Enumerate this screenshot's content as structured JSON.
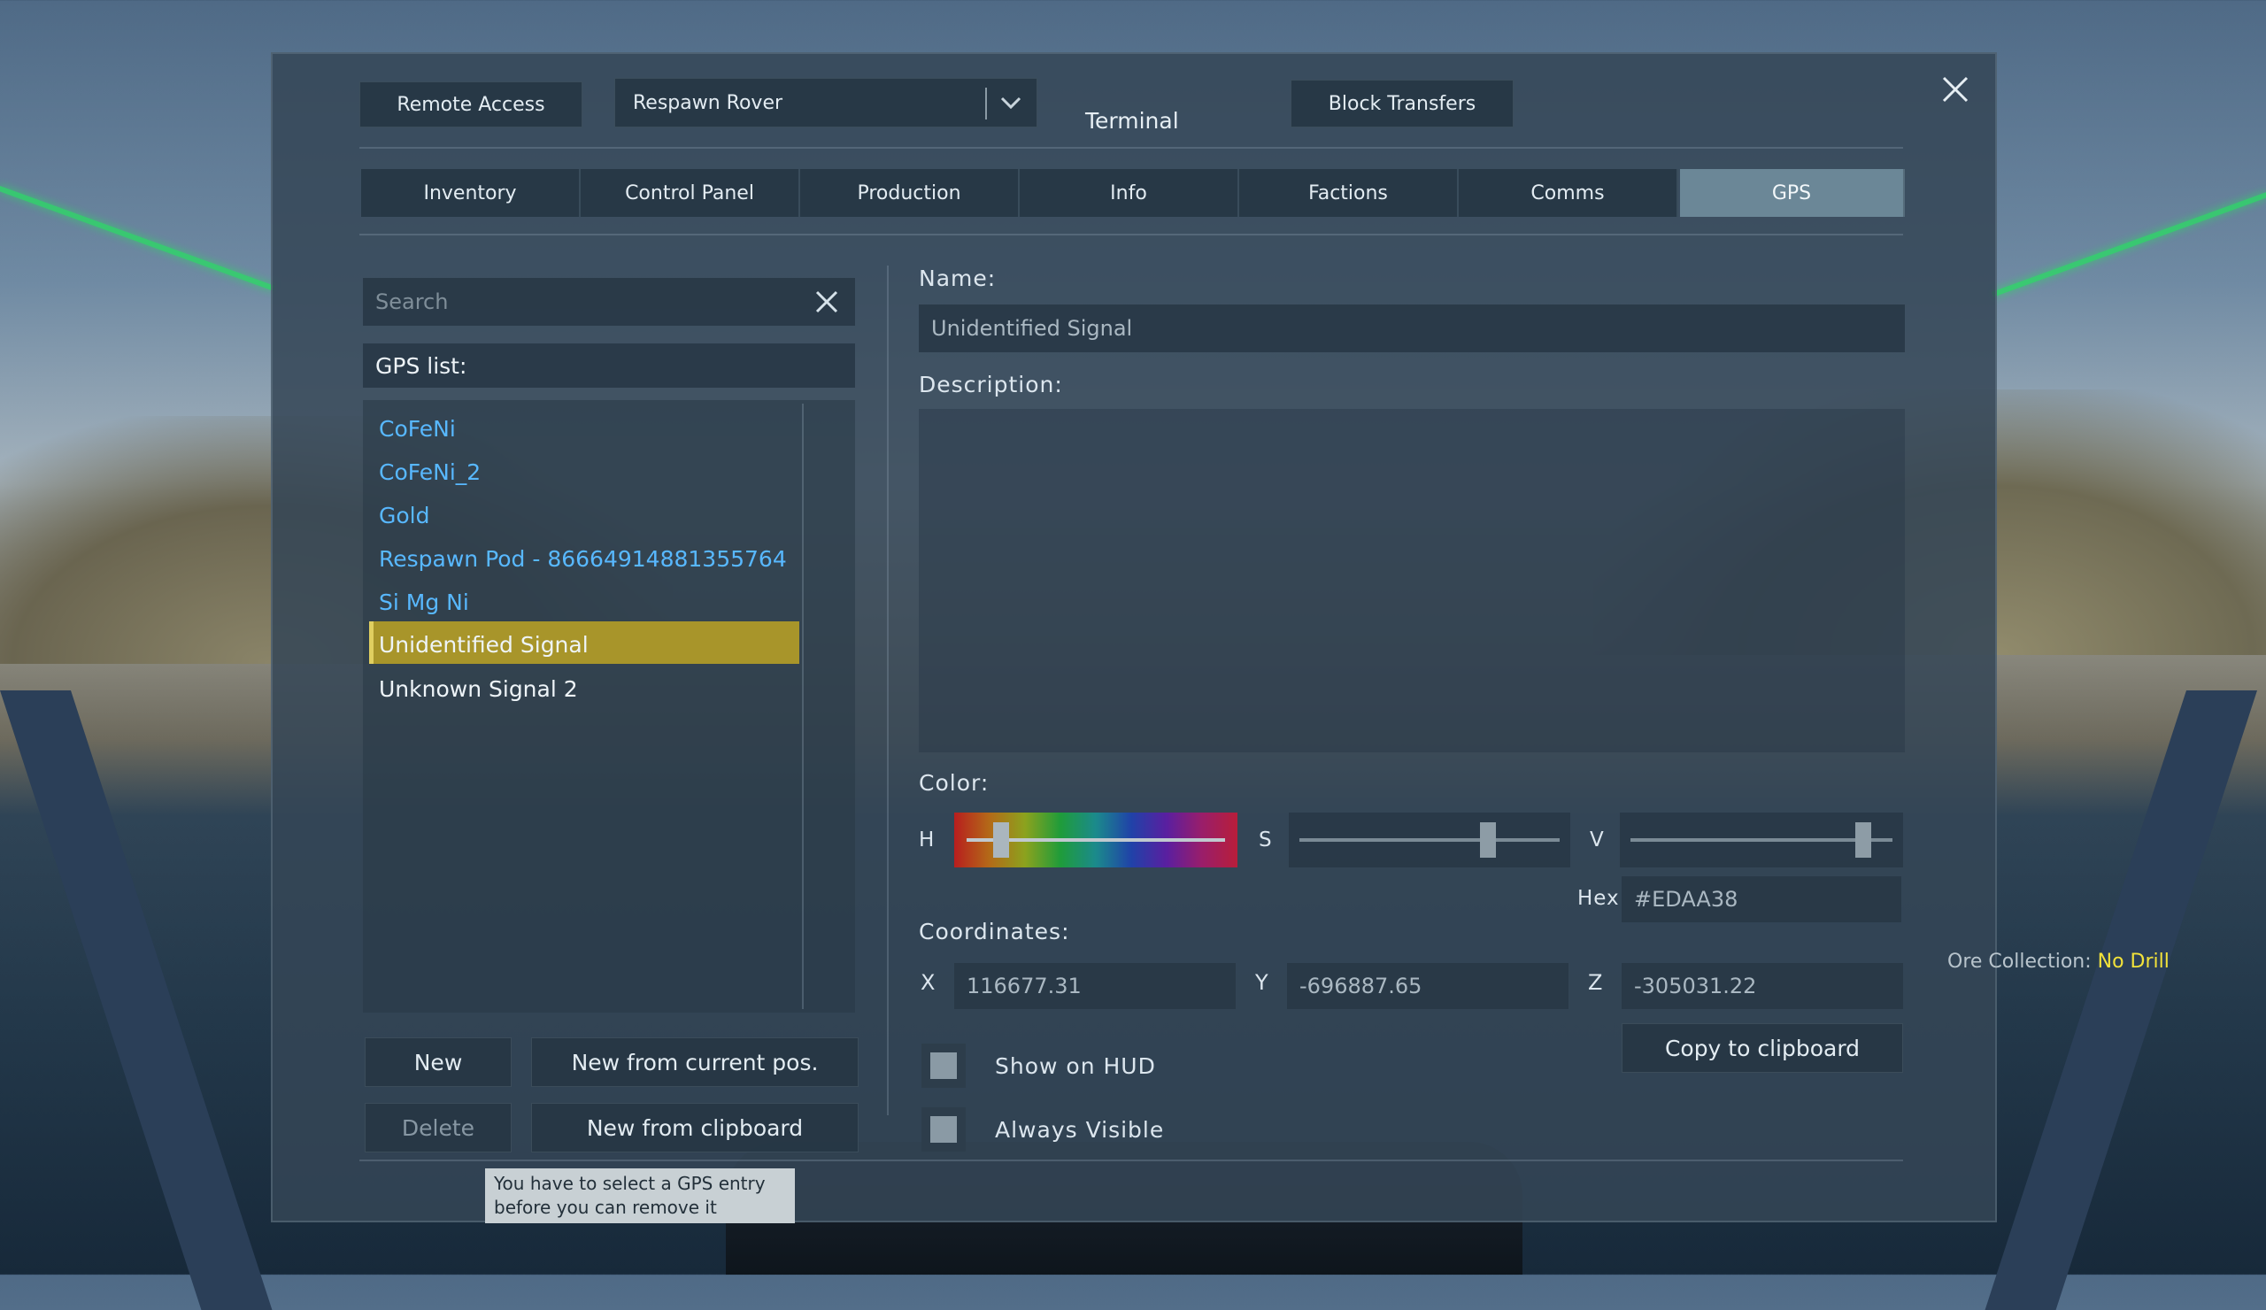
{
  "window": {
    "title": "Terminal"
  },
  "topbar": {
    "remote_access": "Remote Access",
    "block_selector": "Respawn Rover",
    "block_transfers": "Block Transfers"
  },
  "tabs": [
    "Inventory",
    "Control Panel",
    "Production",
    "Info",
    "Factions",
    "Comms",
    "GPS"
  ],
  "active_tab": "GPS",
  "search": {
    "placeholder": "Search"
  },
  "gps_list": {
    "header": "GPS list:",
    "items": [
      {
        "label": "CoFeNi",
        "color": "#58b8ff"
      },
      {
        "label": "CoFeNi_2",
        "color": "#58b8ff"
      },
      {
        "label": "Gold",
        "color": "#58b8ff"
      },
      {
        "label": "Respawn Pod - 86664914881355764",
        "color": "#58b8ff"
      },
      {
        "label": "Si Mg Ni",
        "color": "#58b8ff"
      },
      {
        "label": "Unidentified Signal",
        "color": "#ffffff",
        "selected": true
      },
      {
        "label": "Unknown Signal 2",
        "color": "#ffffff"
      }
    ]
  },
  "buttons": {
    "new": "New",
    "new_current_pos": "New from current pos.",
    "delete": "Delete",
    "new_clipboard": "New from clipboard",
    "copy_clipboard": "Copy to clipboard"
  },
  "tooltip": {
    "line1": "You have to select a GPS entry",
    "line2": "before you can remove it"
  },
  "details": {
    "name_label": "Name:",
    "name_value": "Unidentified Signal",
    "description_label": "Description:",
    "color_label": "Color:",
    "h_label": "H",
    "s_label": "S",
    "v_label": "V",
    "hex_label": "Hex",
    "hex_value": "#EDAA38",
    "coordinates_label": "Coordinates:",
    "x_label": "X",
    "x_value": "116677.31",
    "y_label": "Y",
    "y_value": "-696887.65",
    "z_label": "Z",
    "z_value": "-305031.22",
    "show_on_hud": "Show on  HUD",
    "always_visible": "Always Visible",
    "hue_level": 0.15,
    "saturation_level": 0.7,
    "value_level": 0.9
  },
  "hud": {
    "ore_label": "Ore Collection:",
    "ore_value": "No Drill"
  },
  "colors": {
    "accent_selected": "#a8952a",
    "active_tab": "#6b8797",
    "link": "#58b8ff"
  }
}
